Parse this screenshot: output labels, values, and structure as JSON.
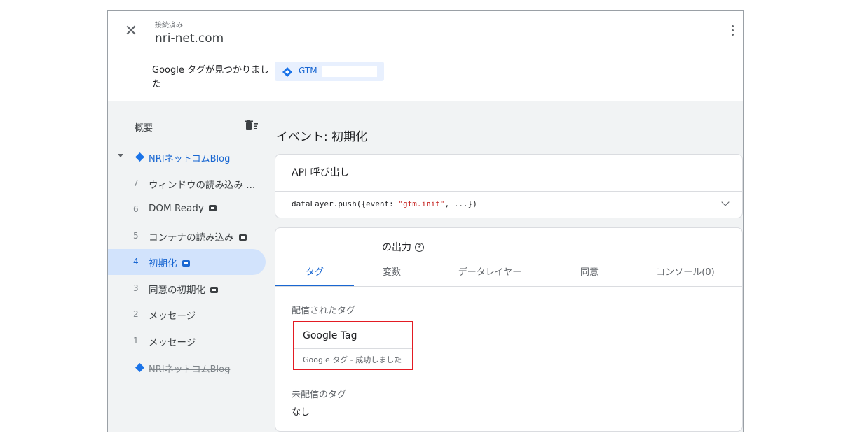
{
  "header": {
    "status": "接続済み",
    "domain": "nri-net.com"
  },
  "found": {
    "text": "Google タグが見つかりました",
    "container_id": "GTM-"
  },
  "sidebar": {
    "summary": "概要",
    "container_name": "NRIネットコムBlog",
    "events": [
      {
        "num": "7",
        "name": "ウィンドウの読み込み ...",
        "badge": false,
        "active": false
      },
      {
        "num": "6",
        "name": "DOM Ready",
        "badge": true,
        "active": false
      },
      {
        "num": "5",
        "name": "コンテナの読み込み",
        "badge": true,
        "active": false
      },
      {
        "num": "4",
        "name": "初期化",
        "badge": true,
        "active": true
      },
      {
        "num": "3",
        "name": "同意の初期化",
        "badge": true,
        "active": false
      },
      {
        "num": "2",
        "name": "メッセージ",
        "badge": false,
        "active": false
      },
      {
        "num": "1",
        "name": "メッセージ",
        "badge": false,
        "active": false
      }
    ],
    "previous_container": "NRIネットコムBlog"
  },
  "main": {
    "event_title": "イベント: 初期化",
    "api_title": "API 呼び出し",
    "api_code_prefix": "dataLayer.push({event: ",
    "api_code_string": "\"gtm.init\"",
    "api_code_suffix": ", ...})",
    "output_title": "の出力",
    "tabs": [
      "タグ",
      "変数",
      "データレイヤー",
      "同意",
      "コンソール(0)"
    ],
    "fired_label": "配信されたタグ",
    "tag_name": "Google Tag",
    "tag_status": "Google タグ - 成功しました",
    "not_fired_label": "未配信のタグ",
    "not_fired_value": "なし"
  },
  "colors": {
    "accent": "#1967d2",
    "highlight_border": "#e31b23",
    "sidebar_bg": "#f1f3f4",
    "active_item_bg": "#d2e3fc"
  }
}
